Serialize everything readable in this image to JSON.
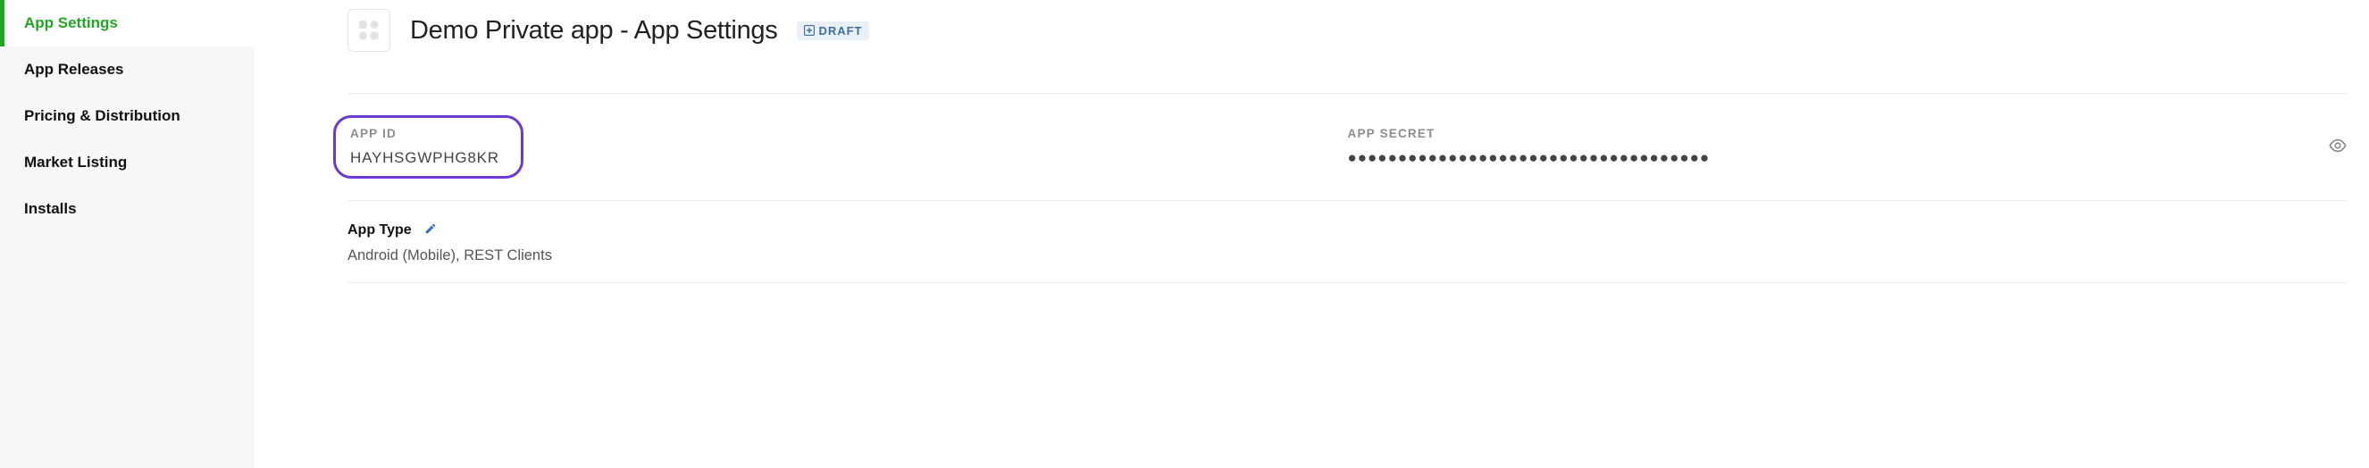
{
  "sidebar": {
    "items": [
      {
        "label": "App Settings",
        "active": true
      },
      {
        "label": "App Releases",
        "active": false
      },
      {
        "label": "Pricing & Distribution",
        "active": false
      },
      {
        "label": "Market Listing",
        "active": false
      },
      {
        "label": "Installs",
        "active": false
      }
    ]
  },
  "header": {
    "title": "Demo Private app - App Settings",
    "badge": {
      "label": "DRAFT"
    }
  },
  "app_id": {
    "label": "APP ID",
    "value": "HAYHSGWPHG8KR"
  },
  "app_secret": {
    "label": "APP SECRET",
    "masked": "●●●●●●●●●●●●●●●●●●●●●●●●●●●●●●●●●●●●"
  },
  "app_type": {
    "label": "App Type",
    "value": "Android (Mobile), REST Clients"
  }
}
